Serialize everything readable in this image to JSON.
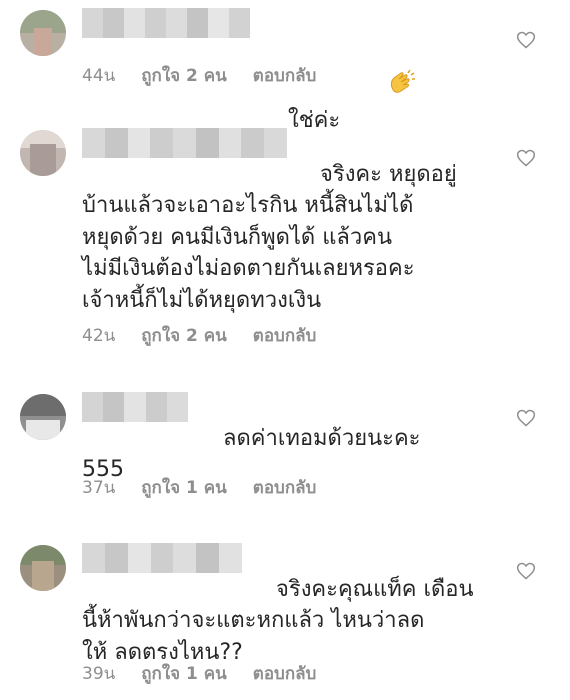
{
  "comments": [
    {
      "text": "ใช่ค่ะ",
      "emoji": "clap-icon",
      "time": "44น",
      "likes": "ถูกใจ 2 คน",
      "reply": "ตอบกลับ"
    },
    {
      "text": "จริงคะ หยุดอยู่\nบ้านแล้วจะเอาอะไรกิน หนี้สินไม่ได้\nหยุดด้วย คนมีเงินก็พูดได้ แล้วคน\nไม่มีเงินต้องไม่อดตายกันเลยหรอคะ\nเจ้าหนี้ก็ไม่ได้หยุดทวงเงิน",
      "time": "42น",
      "likes": "ถูกใจ 2 คน",
      "reply": "ตอบกลับ"
    },
    {
      "text": "ลดค่าเทอมด้วยนะคะ\n555",
      "time": "37น",
      "likes": "ถูกใจ 1 คน",
      "reply": "ตอบกลับ"
    },
    {
      "text": "จริงคะคุณแท็ค เดือน\nนี้ห้าพันกว่าจะแตะหกแล้ว ไหนว่าลด\nให้ ลดตรงไหน??",
      "time": "39น",
      "likes": "ถูกใจ 1 คน",
      "reply": "ตอบกลับ"
    }
  ],
  "colors": {
    "meta": "#8e8e8e",
    "text": "#262626",
    "heart_stroke": "#8e8e8e"
  }
}
